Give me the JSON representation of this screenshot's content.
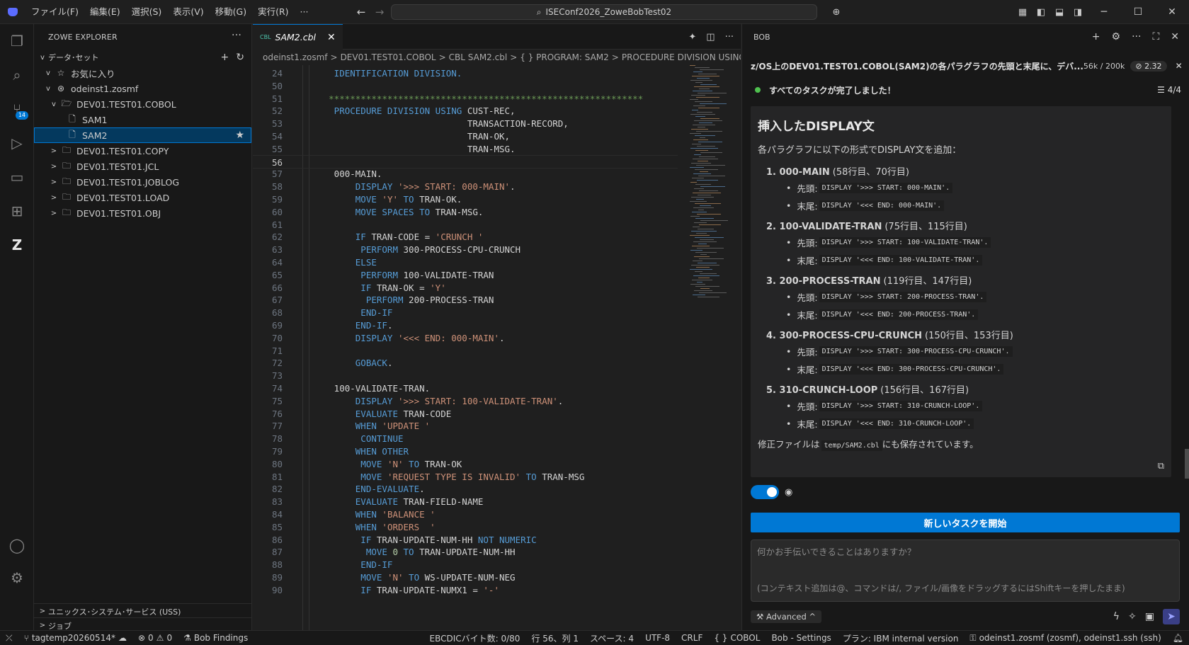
{
  "titlebar": {
    "menus": [
      "ファイル(F)",
      "編集(E)",
      "選択(S)",
      "表示(V)",
      "移動(G)",
      "実行(R)",
      "···"
    ],
    "search": "ISEConf2026_ZoweBobTest02",
    "window_controls": [
      "minimize",
      "maximize",
      "close"
    ]
  },
  "activity": {
    "scm_badge": "14"
  },
  "sidebar": {
    "title": "ZOWE EXPLORER",
    "section": "データ･セット",
    "tree": [
      {
        "label": "お気に入り",
        "level": 1,
        "icon": "favorites-icon",
        "chev": "v"
      },
      {
        "label": "odeinst1.zosmf",
        "level": 1,
        "icon": "profile-icon",
        "chev": "v"
      },
      {
        "label": "DEV01.TEST01.COBOL",
        "level": 2,
        "icon": "folder-open-icon",
        "chev": "v"
      },
      {
        "label": "SAM1",
        "level": 3,
        "icon": "file-icon",
        "chev": ""
      },
      {
        "label": "SAM2",
        "level": 3,
        "icon": "file-icon",
        "chev": "",
        "selected": true
      },
      {
        "label": "DEV01.TEST01.COPY",
        "level": 2,
        "icon": "folder-icon",
        "chev": ">"
      },
      {
        "label": "DEV01.TEST01.JCL",
        "level": 2,
        "icon": "folder-icon",
        "chev": ">"
      },
      {
        "label": "DEV01.TEST01.JOBLOG",
        "level": 2,
        "icon": "folder-icon",
        "chev": ">"
      },
      {
        "label": "DEV01.TEST01.LOAD",
        "level": 2,
        "icon": "folder-icon",
        "chev": ">"
      },
      {
        "label": "DEV01.TEST01.OBJ",
        "level": 2,
        "icon": "folder-icon",
        "chev": ">"
      }
    ],
    "uss": "ユニックス･システム･サービス (USS)",
    "jobs": "ジョブ"
  },
  "editor": {
    "tab_badge": "CBL",
    "tab_label": "SAM2.cbl",
    "breadcrumb": [
      "odeinst1.zosmf",
      "DEV01.TEST01.COBOL",
      "CBL SAM2.cbl",
      "{ } PROGRAM: SAM2",
      "PROCEDURE DIVISION USING C"
    ],
    "lines": [
      {
        "n": "24",
        "segs": [
          [
            "k",
            "       IDENTIFICATION DIVISION."
          ]
        ]
      },
      {
        "n": "50",
        "segs": []
      },
      {
        "n": "51",
        "segs": [
          [
            "c",
            "      ***********************************************************"
          ]
        ]
      },
      {
        "n": "52",
        "segs": [
          [
            "k",
            "       PROCEDURE DIVISION USING "
          ],
          [
            "t",
            "CUST-REC,"
          ]
        ]
      },
      {
        "n": "53",
        "segs": [
          [
            "t",
            "                                TRANSACTION-RECORD,"
          ]
        ]
      },
      {
        "n": "54",
        "segs": [
          [
            "t",
            "                                TRAN-OK,"
          ]
        ]
      },
      {
        "n": "55",
        "segs": [
          [
            "t",
            "                                TRAN-MSG."
          ]
        ]
      },
      {
        "n": "56",
        "segs": [],
        "cur": true
      },
      {
        "n": "57",
        "segs": [
          [
            "t",
            "       000-MAIN."
          ]
        ]
      },
      {
        "n": "58",
        "segs": [
          [
            "k",
            "           DISPLAY "
          ],
          [
            "s",
            "'>>> START: 000-MAIN'"
          ],
          [
            "t",
            "."
          ]
        ]
      },
      {
        "n": "59",
        "segs": [
          [
            "k",
            "           MOVE "
          ],
          [
            "s",
            "'Y'"
          ],
          [
            "k",
            " TO "
          ],
          [
            "t",
            "TRAN-OK."
          ]
        ]
      },
      {
        "n": "60",
        "segs": [
          [
            "k",
            "           MOVE SPACES TO "
          ],
          [
            "t",
            "TRAN-MSG."
          ]
        ]
      },
      {
        "n": "61",
        "segs": []
      },
      {
        "n": "62",
        "segs": [
          [
            "k",
            "           IF "
          ],
          [
            "t",
            "TRAN-CODE = "
          ],
          [
            "s",
            "'CRUNCH '"
          ]
        ]
      },
      {
        "n": "63",
        "segs": [
          [
            "k",
            "            PERFORM "
          ],
          [
            "t",
            "300-PROCESS-CPU-CRUNCH"
          ]
        ]
      },
      {
        "n": "64",
        "segs": [
          [
            "k",
            "           ELSE"
          ]
        ]
      },
      {
        "n": "65",
        "segs": [
          [
            "k",
            "            PERFORM "
          ],
          [
            "t",
            "100-VALIDATE-TRAN"
          ]
        ]
      },
      {
        "n": "66",
        "segs": [
          [
            "k",
            "            IF "
          ],
          [
            "t",
            "TRAN-OK = "
          ],
          [
            "s",
            "'Y'"
          ]
        ]
      },
      {
        "n": "67",
        "segs": [
          [
            "k",
            "             PERFORM "
          ],
          [
            "t",
            "200-PROCESS-TRAN"
          ]
        ]
      },
      {
        "n": "68",
        "segs": [
          [
            "k",
            "            END-IF"
          ]
        ]
      },
      {
        "n": "69",
        "segs": [
          [
            "k",
            "           END-IF"
          ],
          [
            "t",
            "."
          ]
        ]
      },
      {
        "n": "70",
        "segs": [
          [
            "k",
            "           DISPLAY "
          ],
          [
            "s",
            "'<<< END: 000-MAIN'"
          ],
          [
            "t",
            "."
          ]
        ]
      },
      {
        "n": "71",
        "segs": []
      },
      {
        "n": "72",
        "segs": [
          [
            "k",
            "           GOBACK"
          ],
          [
            "t",
            "."
          ]
        ]
      },
      {
        "n": "73",
        "segs": []
      },
      {
        "n": "74",
        "segs": [
          [
            "t",
            "       100-VALIDATE-TRAN."
          ]
        ]
      },
      {
        "n": "75",
        "segs": [
          [
            "k",
            "           DISPLAY "
          ],
          [
            "s",
            "'>>> START: 100-VALIDATE-TRAN'"
          ],
          [
            "t",
            "."
          ]
        ]
      },
      {
        "n": "76",
        "segs": [
          [
            "k",
            "           EVALUATE "
          ],
          [
            "t",
            "TRAN-CODE"
          ]
        ]
      },
      {
        "n": "77",
        "segs": [
          [
            "k",
            "           WHEN "
          ],
          [
            "s",
            "'UPDATE '"
          ]
        ]
      },
      {
        "n": "78",
        "segs": [
          [
            "k",
            "            CONTINUE"
          ]
        ]
      },
      {
        "n": "79",
        "segs": [
          [
            "k",
            "           WHEN OTHER"
          ]
        ]
      },
      {
        "n": "80",
        "segs": [
          [
            "k",
            "            MOVE "
          ],
          [
            "s",
            "'N'"
          ],
          [
            "k",
            " TO "
          ],
          [
            "t",
            "TRAN-OK"
          ]
        ]
      },
      {
        "n": "81",
        "segs": [
          [
            "k",
            "            MOVE "
          ],
          [
            "s",
            "'REQUEST TYPE IS INVALID'"
          ],
          [
            "k",
            " TO "
          ],
          [
            "t",
            "TRAN-MSG"
          ]
        ]
      },
      {
        "n": "82",
        "segs": [
          [
            "k",
            "           END-EVALUATE"
          ],
          [
            "t",
            "."
          ]
        ]
      },
      {
        "n": "83",
        "segs": [
          [
            "k",
            "           EVALUATE "
          ],
          [
            "t",
            "TRAN-FIELD-NAME"
          ]
        ]
      },
      {
        "n": "84",
        "segs": [
          [
            "k",
            "           WHEN "
          ],
          [
            "s",
            "'BALANCE '"
          ]
        ]
      },
      {
        "n": "85",
        "segs": [
          [
            "k",
            "           WHEN "
          ],
          [
            "s",
            "'ORDERS  '"
          ]
        ]
      },
      {
        "n": "86",
        "segs": [
          [
            "k",
            "            IF "
          ],
          [
            "t",
            "TRAN-UPDATE-NUM-HH "
          ],
          [
            "k",
            "NOT NUMERIC"
          ]
        ]
      },
      {
        "n": "87",
        "segs": [
          [
            "k",
            "             MOVE "
          ],
          [
            "n",
            "0"
          ],
          [
            "k",
            " TO "
          ],
          [
            "t",
            "TRAN-UPDATE-NUM-HH"
          ]
        ]
      },
      {
        "n": "88",
        "segs": [
          [
            "k",
            "            END-IF"
          ]
        ]
      },
      {
        "n": "89",
        "segs": [
          [
            "k",
            "            MOVE "
          ],
          [
            "s",
            "'N'"
          ],
          [
            "k",
            " TO "
          ],
          [
            "t",
            "WS-UPDATE-NUM-NEG"
          ]
        ]
      },
      {
        "n": "90",
        "segs": [
          [
            "k",
            "            IF "
          ],
          [
            "t",
            "TRAN-UPDATE-NUMX1 = "
          ],
          [
            "s",
            "'-'"
          ]
        ]
      }
    ]
  },
  "chat": {
    "title": "BOB",
    "task_title": "z/OS上のDEV01.TEST01.COBOL(SAM2)の各パラグラフの先頭と末尾に、デバ...",
    "tokens": "56k / 200k",
    "cost": "2.32",
    "done_text": "すべてのタスクが完了しました！",
    "done_count": "4/4",
    "heading": "挿入したDISPLAY文",
    "intro": "各パラグラフに以下の形式でDISPLAY文を追加：",
    "head_label": "先頭:",
    "tail_label": "末尾:",
    "items": [
      {
        "num": "1. 000-MAIN",
        "lines": "(58行目、70行目)",
        "start": "DISPLAY '>>> START: 000-MAIN'.",
        "end": "DISPLAY '<<< END: 000-MAIN'."
      },
      {
        "num": "2. 100-VALIDATE-TRAN",
        "lines": "(75行目、115行目)",
        "start": "DISPLAY '>>> START: 100-VALIDATE-TRAN'.",
        "end": "DISPLAY '<<< END: 100-VALIDATE-TRAN'."
      },
      {
        "num": "3. 200-PROCESS-TRAN",
        "lines": "(119行目、147行目)",
        "start": "DISPLAY '>>> START: 200-PROCESS-TRAN'.",
        "end": "DISPLAY '<<< END: 200-PROCESS-TRAN'."
      },
      {
        "num": "4. 300-PROCESS-CPU-CRUNCH",
        "lines": "(150行目、153行目)",
        "start": "DISPLAY '>>> START: 300-PROCESS-CPU-CRUNCH'.",
        "end": "DISPLAY '<<< END: 300-PROCESS-CPU-CRUNCH'."
      },
      {
        "num": "5. 310-CRUNCH-LOOP",
        "lines": "(156行目、167行目)",
        "start": "DISPLAY '>>> START: 310-CRUNCH-LOOP'.",
        "end": "DISPLAY '<<< END: 310-CRUNCH-LOOP'."
      }
    ],
    "footer_pre": "修正ファイルは",
    "footer_code": "temp/SAM2.cbl",
    "footer_post": "にも保存されています。",
    "new_task": "新しいタスクを開始",
    "input_placeholder": "何かお手伝いできることはありますか？",
    "input_hint": "(コンテキスト追加は@、コマンドは/, ファイル/画像をドラッグするにはShiftキーを押したまま)",
    "mode": "Advanced"
  },
  "status": {
    "branch": "tagtemp20260514*",
    "errors": "0",
    "warnings": "0",
    "findings": "Bob Findings",
    "ebcdic": "EBCDICバイト数: 0/80",
    "position": "行 56、列 1",
    "spaces": "スペース: 4",
    "encoding": "UTF-8",
    "eol": "CRLF",
    "language": "COBOL",
    "bob_settings": "Bob - Settings",
    "plan": "プラン: IBM internal version",
    "remote": "odeinst1.zosmf (zosmf), odeinst1.ssh (ssh)"
  }
}
